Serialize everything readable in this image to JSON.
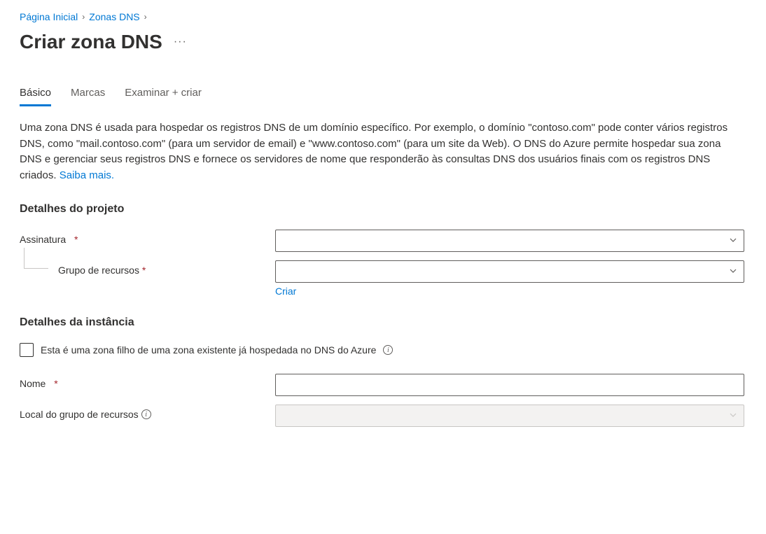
{
  "breadcrumb": {
    "items": [
      {
        "label": "Página Inicial"
      },
      {
        "label": "Zonas DNS"
      }
    ]
  },
  "page": {
    "title": "Criar zona DNS"
  },
  "tabs": [
    {
      "label": "Básico",
      "active": true
    },
    {
      "label": "Marcas",
      "active": false
    },
    {
      "label": "Examinar + criar",
      "active": false
    }
  ],
  "description": {
    "text": "Uma zona DNS é usada para hospedar os registros DNS de um domínio específico. Por exemplo, o domínio \"contoso.com\" pode conter vários registros DNS, como \"mail.contoso.com\" (para um servidor de email) e \"www.contoso.com\" (para um site da Web). O DNS do Azure permite hospedar sua zona DNS e gerenciar seus registros DNS e fornece os servidores de nome que responderão às consultas DNS dos usuários finais com os registros DNS criados. ",
    "learn_more": "Saiba mais."
  },
  "project_details": {
    "heading": "Detalhes do projeto",
    "subscription": {
      "label": "Assinatura",
      "value": ""
    },
    "resource_group": {
      "label": "Grupo de recursos",
      "value": "",
      "create_link": "Criar"
    }
  },
  "instance_details": {
    "heading": "Detalhes da instância",
    "child_zone_checkbox": {
      "label": "Esta é uma zona filho de uma zona existente já hospedada no DNS do Azure",
      "checked": false
    },
    "name": {
      "label": "Nome",
      "value": ""
    },
    "resource_group_location": {
      "label": "Local do grupo de recursos",
      "value": ""
    }
  }
}
